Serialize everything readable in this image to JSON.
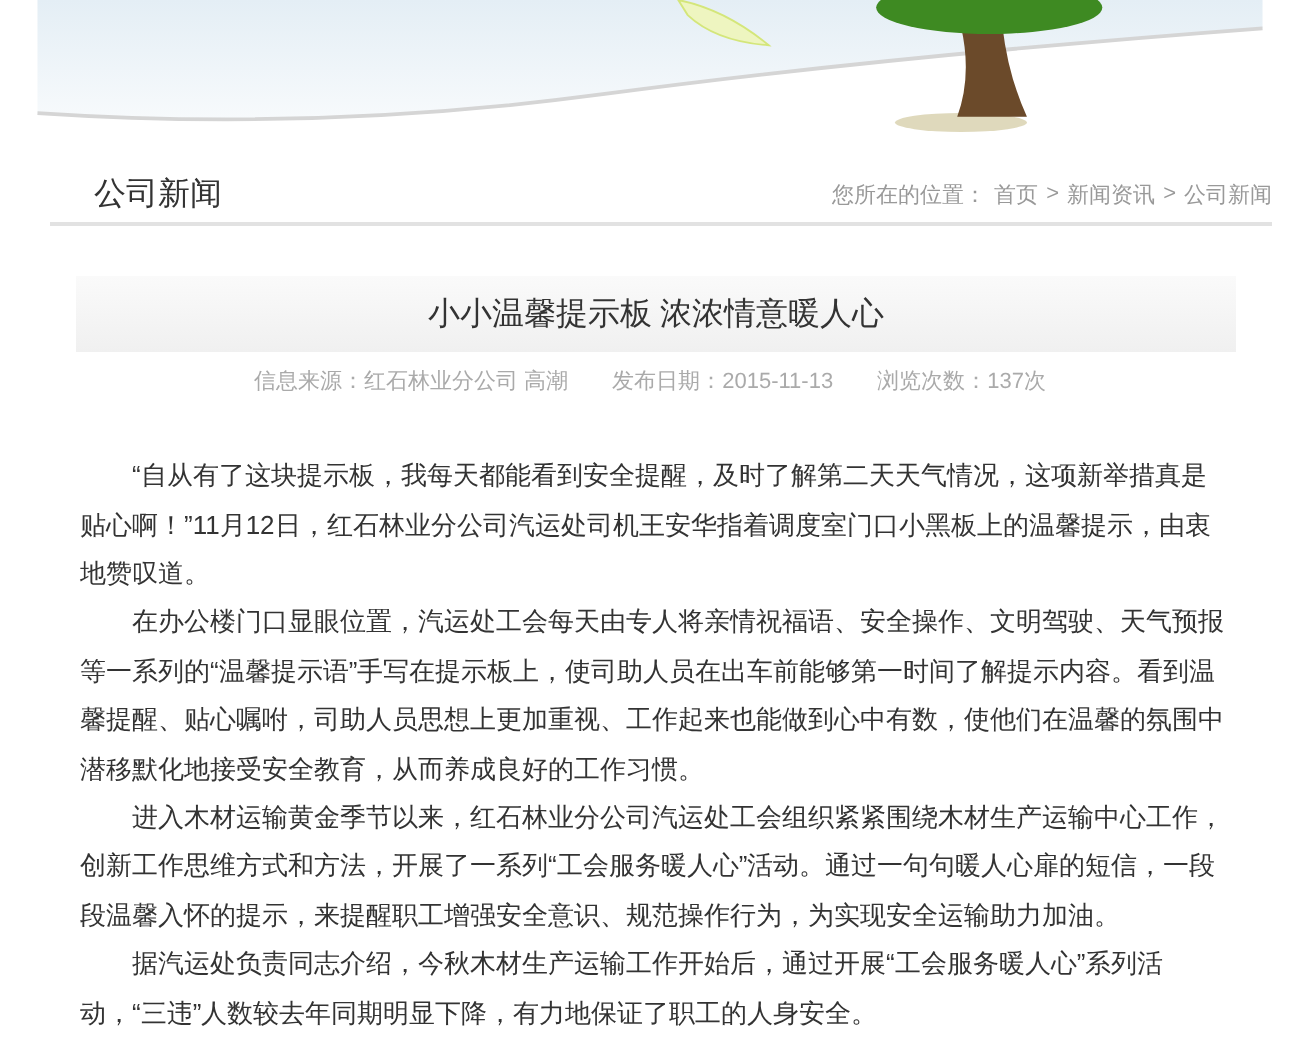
{
  "section": {
    "title": "公司新闻"
  },
  "breadcrumb": {
    "label": "您所在的位置：",
    "separator": ">",
    "items": [
      "首页",
      "新闻资讯",
      "公司新闻"
    ]
  },
  "article": {
    "title": "小小温馨提示板 浓浓情意暖人心",
    "meta": [
      "信息来源：红石林业分公司 高潮",
      "发布日期：2015-11-13",
      "浏览次数：137次"
    ],
    "paragraphs": [
      "“自从有了这块提示板，我每天都能看到安全提醒，及时了解第二天天气情况，这项新举措真是贴心啊！”11月12日，红石林业分公司汽运处司机王安华指着调度室门口小黑板上的温馨提示，由衷地赞叹道。",
      "在办公楼门口显眼位置，汽运处工会每天由专人将亲情祝福语、安全操作、文明驾驶、天气预报等一系列的“温馨提示语”手写在提示板上，使司助人员在出车前能够第一时间了解提示内容。看到温馨提醒、贴心嘱咐，司助人员思想上更加重视、工作起来也能做到心中有数，使他们在温馨的氛围中潜移默化地接受安全教育，从而养成良好的工作习惯。",
      "进入木材运输黄金季节以来，红石林业分公司汽运处工会组织紧紧围绕木材生产运输中心工作，创新工作思维方式和方法，开展了一系列“工会服务暖人心”活动。通过一句句暖人心扉的短信，一段段温馨入怀的提示，来提醒职工增强安全意识、规范操作行为，为实现安全运输助力加油。",
      "据汽运处负责同志介绍，今秋木材生产运输工作开始后，通过开展“工会服务暖人心”系列活动，“三违”人数较去年同期明显下降，有力地保证了职工的人身安全。"
    ]
  }
}
